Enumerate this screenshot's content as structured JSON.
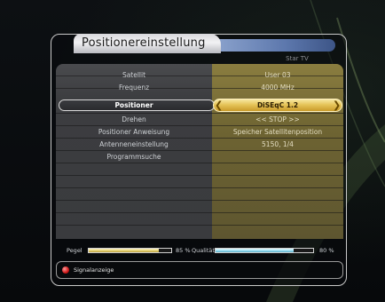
{
  "window": {
    "title": "Positionereinstellung",
    "provider": "Star TV"
  },
  "menu": {
    "rows": [
      {
        "label": "Satellit",
        "value": "User 03"
      },
      {
        "label": "Frequenz",
        "value": "4000 MHz"
      },
      {
        "label": "Positioner",
        "value": "DiSEqC 1.2",
        "selected": true
      },
      {
        "label": "Drehen",
        "value": "<< STOP >>"
      },
      {
        "label": "Positioner Anweisung",
        "value": "Speicher Satellitenposition"
      },
      {
        "label": "Antenneneinstellung",
        "value": "5150, 1/4"
      },
      {
        "label": "Programmsuche",
        "value": ""
      }
    ]
  },
  "signal": {
    "pegel_label": "Pegel",
    "pegel_percent_text": "85 %",
    "pegel_level": 0.85,
    "qualitaet_label": "Qualität",
    "qualitaet_percent_text": "80 %",
    "qualitaet_level": 0.8
  },
  "footer": {
    "hint": "Signalanzeige"
  },
  "colors": {
    "accent_gold": "#e6c55a",
    "hint_red": "#d01818",
    "pegel_bar": "#e8d680",
    "qualitaet_bar": "#a6e3f5"
  },
  "icons": {
    "left_arrow": "chevron-left-icon",
    "right_arrow": "chevron-right-icon",
    "red_button": "red-button-icon"
  }
}
